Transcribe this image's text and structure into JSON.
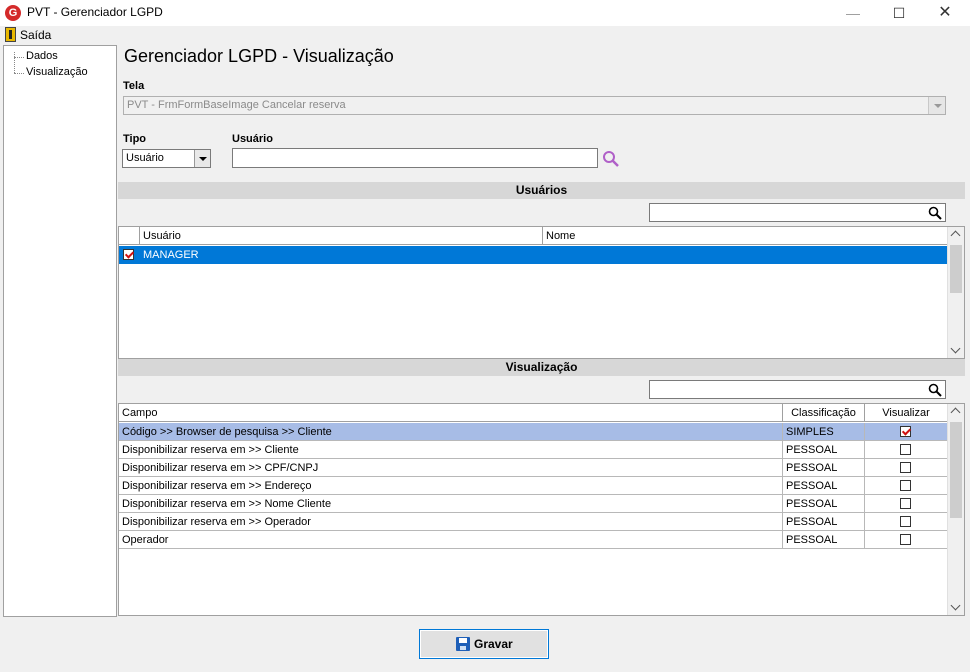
{
  "window": {
    "title": "PVT - Gerenciador LGPD",
    "logo_letter": "G",
    "minimize": "—",
    "maximize": "☐",
    "close": "✕"
  },
  "menu": {
    "exit_label": "Saída"
  },
  "tree": {
    "items": [
      "Dados",
      "Visualização"
    ]
  },
  "page": {
    "title": "Gerenciador LGPD - Visualização"
  },
  "tela": {
    "label": "Tela",
    "value": "PVT - FrmFormBaseImage Cancelar reserva"
  },
  "tipo": {
    "label": "Tipo",
    "value": "Usuário"
  },
  "usuario": {
    "label": "Usuário",
    "value": ""
  },
  "usuarios_section": {
    "title": "Usuários",
    "columns": [
      "Usuário",
      "Nome"
    ],
    "rows": [
      {
        "checked": true,
        "usuario": "MANAGER",
        "nome": ""
      }
    ]
  },
  "visualizacao_section": {
    "title": "Visualização",
    "columns": [
      "Campo",
      "Classificação",
      "Visualizar"
    ],
    "rows": [
      {
        "campo": "Código >> Browser de pesquisa >> Cliente",
        "classificacao": "SIMPLES",
        "visualizar": true
      },
      {
        "campo": "Disponibilizar reserva em >> Cliente",
        "classificacao": "PESSOAL",
        "visualizar": false
      },
      {
        "campo": "Disponibilizar reserva em >> CPF/CNPJ",
        "classificacao": "PESSOAL",
        "visualizar": false
      },
      {
        "campo": "Disponibilizar reserva em >> Endereço",
        "classificacao": "PESSOAL",
        "visualizar": false
      },
      {
        "campo": "Disponibilizar reserva em >> Nome Cliente",
        "classificacao": "PESSOAL",
        "visualizar": false
      },
      {
        "campo": "Disponibilizar reserva em >> Operador",
        "classificacao": "PESSOAL",
        "visualizar": false
      },
      {
        "campo": "Operador",
        "classificacao": "PESSOAL",
        "visualizar": false
      }
    ]
  },
  "actions": {
    "save_label": "Gravar"
  },
  "colors": {
    "selection": "#0078d7",
    "selection_light": "#a7bce6",
    "section_bar": "#d7d7d7",
    "logo": "#d42a2a"
  },
  "icons": [
    "app-logo-icon",
    "exit-icon",
    "search-icon",
    "save-icon"
  ]
}
